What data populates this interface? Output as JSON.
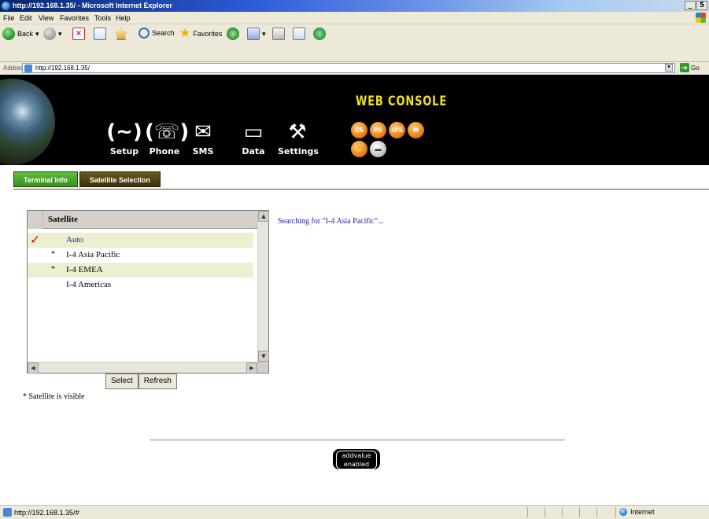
{
  "window": {
    "title": "http://192.168.1.35/ - Microsoft Internet Explorer",
    "controls": {
      "minimize": "_",
      "restore": "5",
      "close": "x"
    }
  },
  "menu": [
    "File",
    "Edit",
    "View",
    "Favorites",
    "Tools",
    "Help"
  ],
  "toolbar": {
    "back": "Back",
    "search": "Search",
    "favorites": "Favorites"
  },
  "address": {
    "label": "Address",
    "url": "http://192.168.1.35/",
    "go": "Go"
  },
  "banner": {
    "title": "WEB CONSOLE",
    "nav": [
      {
        "label": "Setup",
        "glyph": "(~)",
        "icon": "satellite-signal-icon"
      },
      {
        "label": "Phone",
        "glyph": "(☏)",
        "icon": "phone-icon"
      },
      {
        "label": "SMS",
        "glyph": "✉",
        "icon": "envelope-icon"
      },
      {
        "label": "Data",
        "glyph": "▭",
        "icon": "monitor-icon"
      },
      {
        "label": "Settings",
        "glyph": "⚒",
        "icon": "tools-icon"
      }
    ],
    "services": [
      "CS",
      "PS",
      "sPS",
      "✉",
      "✋",
      "▬"
    ]
  },
  "tabs": {
    "terminal_info": "Terminal Info",
    "satellite_selection": "Satellite Selection"
  },
  "satellite_list": {
    "header": "Satellite",
    "rows": [
      {
        "check": "✓",
        "star": "",
        "name": "Auto"
      },
      {
        "check": "",
        "star": "*",
        "name": "I-4 Asia Pacific"
      },
      {
        "check": "",
        "star": "*",
        "name": "I-4 EMEA"
      },
      {
        "check": "",
        "star": "",
        "name": "I-4 Americas"
      }
    ]
  },
  "buttons": {
    "select": "Select",
    "refresh": "Refresh"
  },
  "legend": "* Satellite is visible",
  "status_message": "Searching for \"I-4 Asia Pacific\"...",
  "logo": {
    "line1": "addvalue",
    "line2": "enabled"
  },
  "statusbar": {
    "url": "http://192.168.1.35/#",
    "zone": "Internet"
  },
  "colors": {
    "banner_bg": "#000000",
    "brand_yellow": "#f0e020",
    "tab_green": "#3d8f22",
    "tab_brown": "#3b2f0a",
    "check_red": "#cc1100",
    "link_blue": "#1a1aa6",
    "service_orange": "#e77b10"
  }
}
